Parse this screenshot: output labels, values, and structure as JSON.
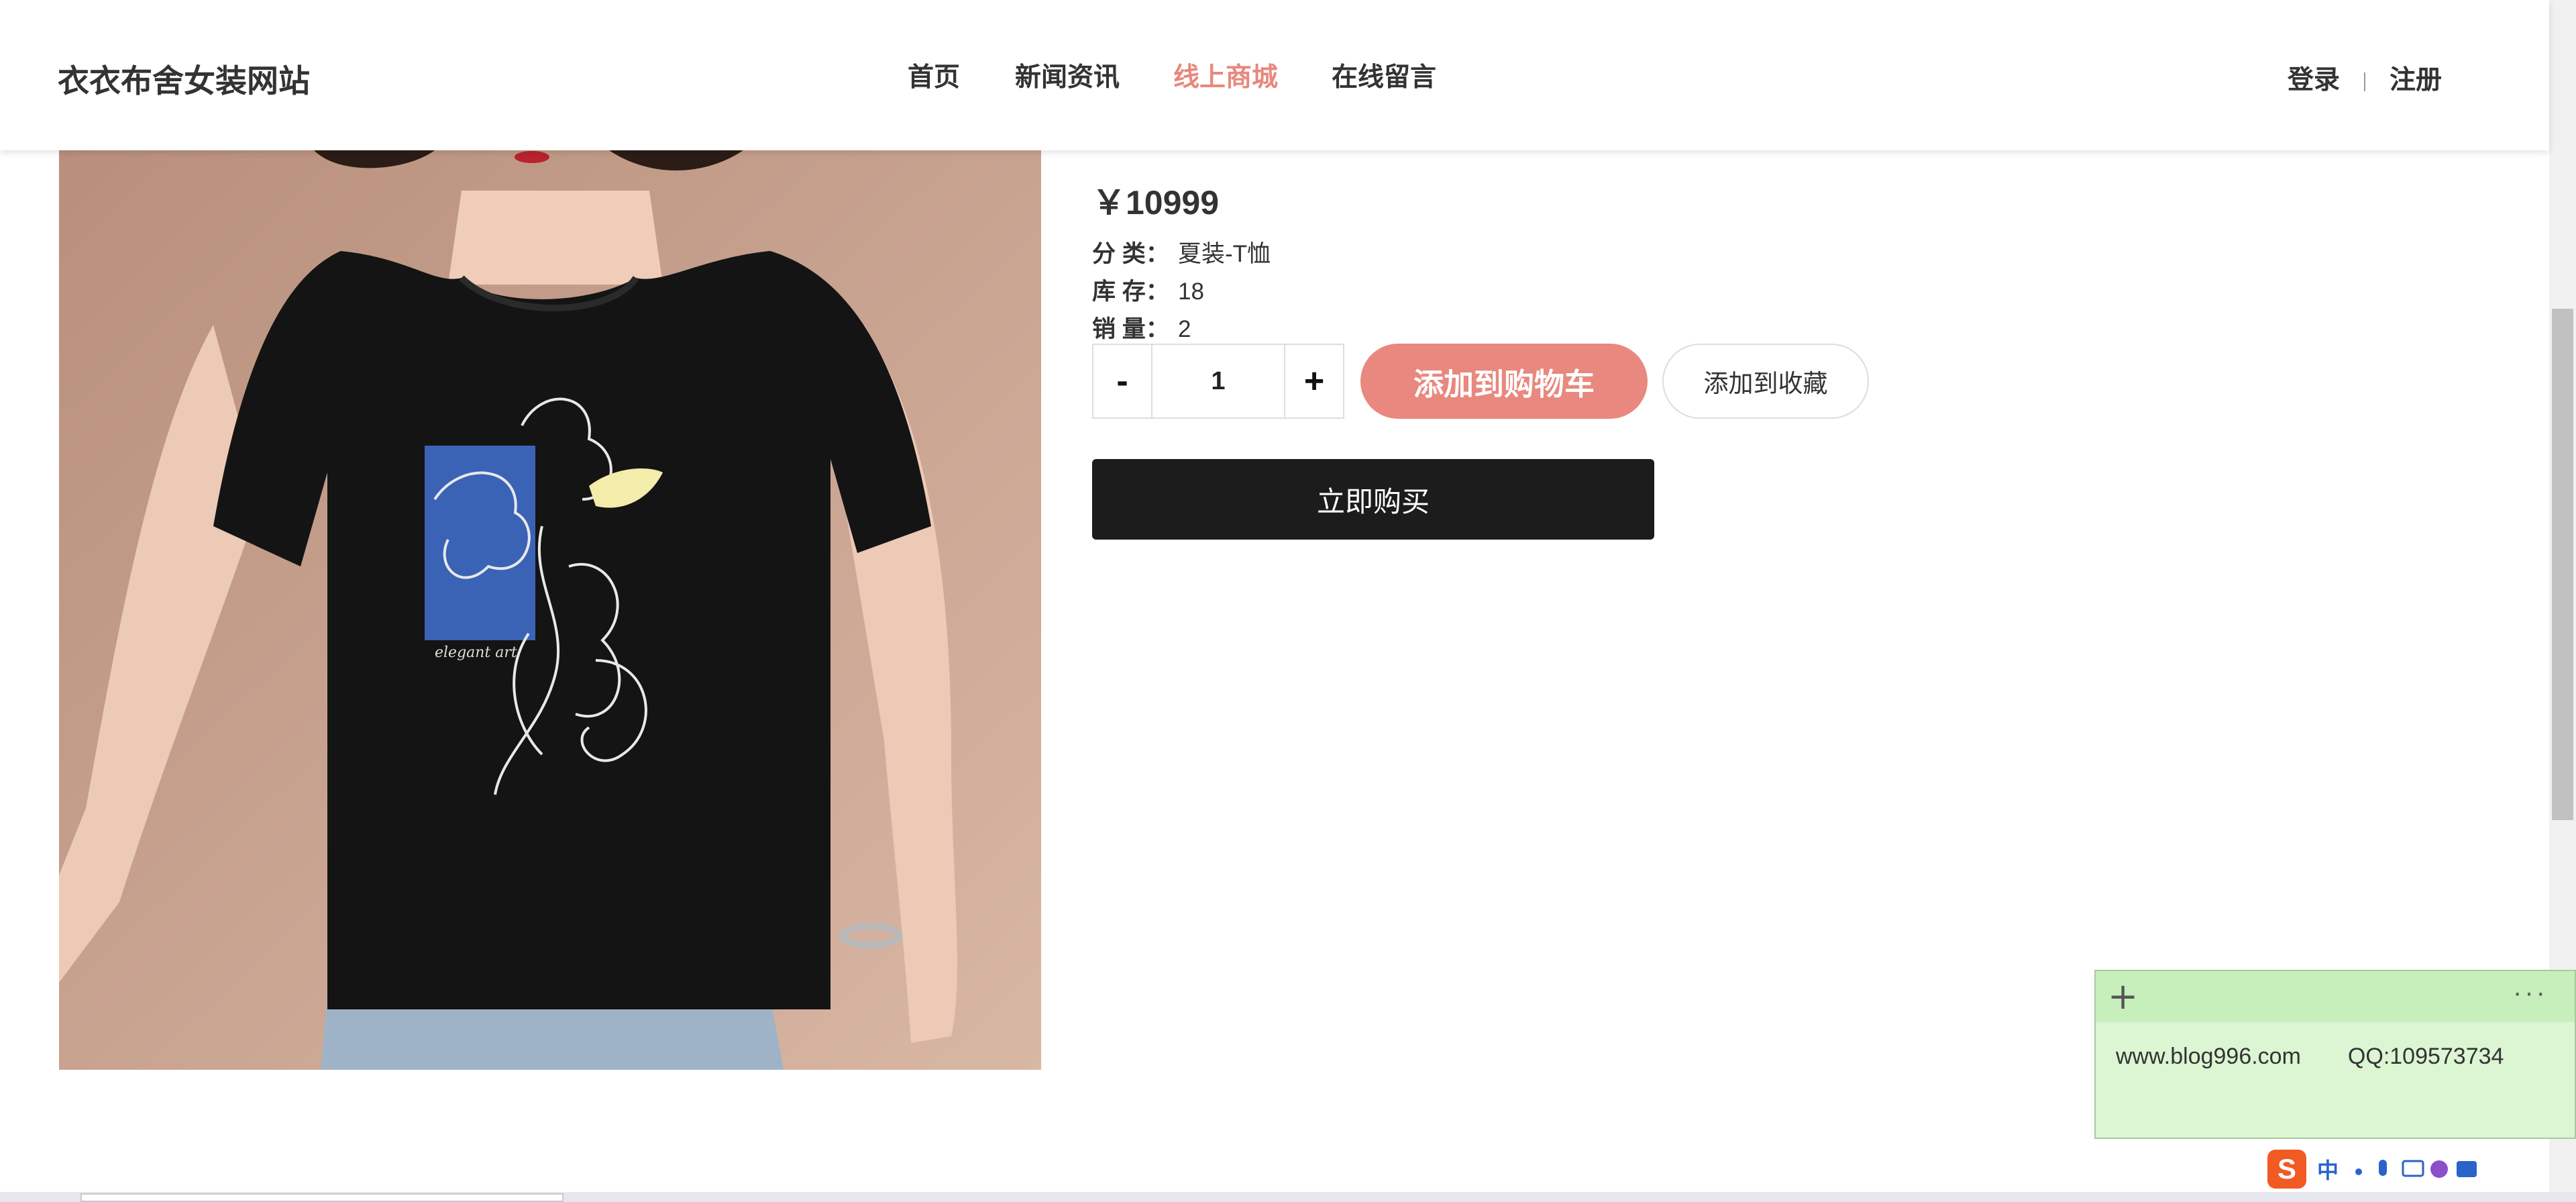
{
  "header": {
    "logo": "衣衣布舍女装网站",
    "nav": [
      {
        "label": "首页",
        "active": false
      },
      {
        "label": "新闻资讯",
        "active": false
      },
      {
        "label": "线上商城",
        "active": true
      },
      {
        "label": "在线留言",
        "active": false
      }
    ],
    "login": "登录",
    "register": "注册"
  },
  "product": {
    "price": "￥10999",
    "category_label": "分 类：",
    "category": "夏装-T恤",
    "stock_label": "库 存：",
    "stock": "18",
    "sales_label": "销 量：",
    "sales": "2",
    "quantity": "1",
    "minus": "-",
    "plus": "+",
    "add_to_cart": "添加到购物车",
    "add_to_favorites": "添加到收藏",
    "buy_now": "立即购买",
    "print_text": "elegant art"
  },
  "sticky_note": {
    "plus": "+",
    "more": "···",
    "text_url": "www.blog996.com",
    "text_qq": "QQ:109573734"
  },
  "ime": {
    "logo": "S",
    "mode": "中"
  },
  "colors": {
    "accent": "#e8887e",
    "buy_button": "#1c1c1c",
    "note_bg": "#dcf5d3",
    "ime_logo": "#f15a22"
  }
}
